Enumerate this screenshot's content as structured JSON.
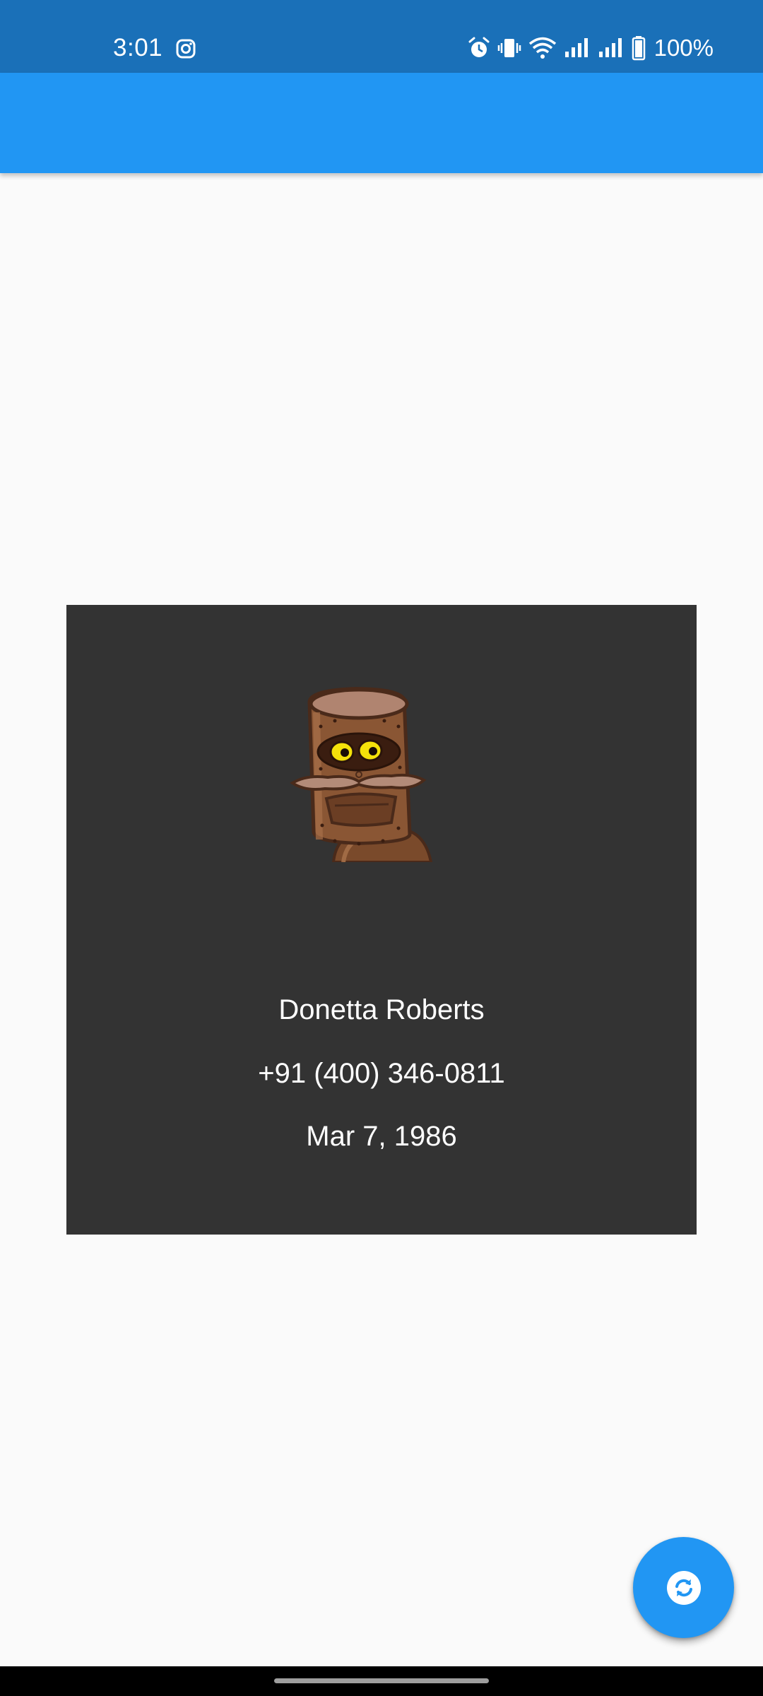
{
  "status_bar": {
    "time": "3:01",
    "battery": "100%",
    "icons": [
      "instagram-icon",
      "alarm-icon",
      "vibrate-icon",
      "wifi-icon",
      "signal-icon",
      "signal-icon",
      "battery-icon"
    ]
  },
  "app_bar": {
    "title": ""
  },
  "profile": {
    "name": "Donetta Roberts",
    "phone": "+91 (400) 346-0811",
    "birthdate": "Mar 7, 1986",
    "avatar_icon": "robot-avatar-icon"
  },
  "fab": {
    "icon": "refresh-icon"
  },
  "colors": {
    "status_bar": "#1a70b8",
    "app_bar": "#2196f3",
    "card": "#333333",
    "fab": "#2196f3",
    "background": "#fafafa"
  }
}
